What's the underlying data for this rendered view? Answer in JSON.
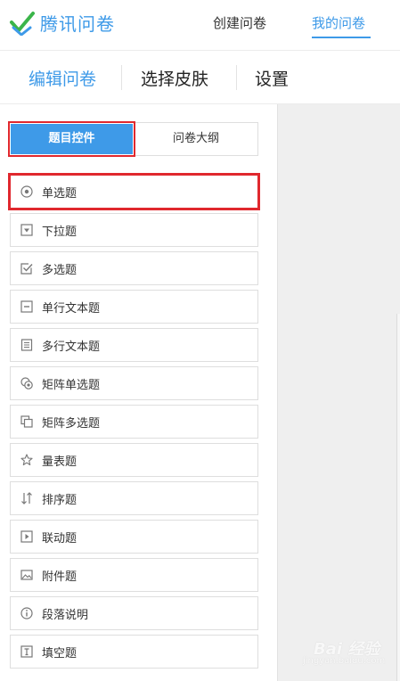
{
  "header": {
    "brand": "腾讯问卷",
    "nav": {
      "create": "创建问卷",
      "mine": "我的问卷"
    }
  },
  "tabs": {
    "edit": "编辑问卷",
    "skin": "选择皮肤",
    "settings": "设置"
  },
  "panel": {
    "tab_controls": "题目控件",
    "tab_outline": "问卷大纲",
    "items": [
      {
        "label": "单选题",
        "icon": "radio-icon"
      },
      {
        "label": "下拉题",
        "icon": "dropdown-icon"
      },
      {
        "label": "多选题",
        "icon": "checkbox-icon"
      },
      {
        "label": "单行文本题",
        "icon": "single-line-text-icon"
      },
      {
        "label": "多行文本题",
        "icon": "multi-line-text-icon"
      },
      {
        "label": "矩阵单选题",
        "icon": "matrix-radio-icon"
      },
      {
        "label": "矩阵多选题",
        "icon": "matrix-checkbox-icon"
      },
      {
        "label": "量表题",
        "icon": "star-icon"
      },
      {
        "label": "排序题",
        "icon": "sort-icon"
      },
      {
        "label": "联动题",
        "icon": "cascade-icon"
      },
      {
        "label": "附件题",
        "icon": "image-icon"
      },
      {
        "label": "段落说明",
        "icon": "info-icon"
      },
      {
        "label": "填空题",
        "icon": "fill-blank-icon"
      }
    ]
  },
  "watermark": {
    "brand": "Bai 经验",
    "url": "jingyan.baidu.com"
  },
  "colors": {
    "accent": "#3e9ae8",
    "highlight": "#e0282e",
    "logo_green": "#3bb54a"
  }
}
